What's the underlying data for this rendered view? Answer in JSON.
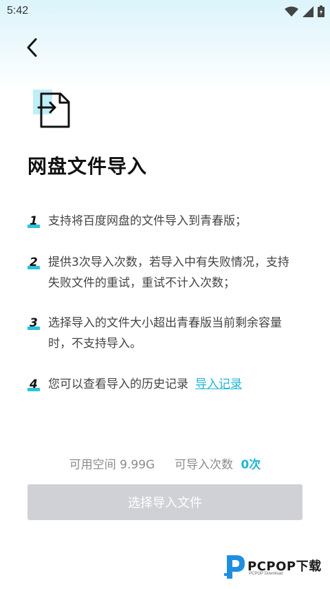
{
  "status_bar": {
    "time": "5:42"
  },
  "page": {
    "title": "网盘文件导入"
  },
  "steps": [
    {
      "num": "1",
      "text": "支持将百度网盘的文件导入到青春版；"
    },
    {
      "num": "2",
      "text": "提供3次导入次数，若导入中有失败情况，支持失败文件的重试，重试不计入次数；"
    },
    {
      "num": "3",
      "text": "选择导入的文件大小超出青春版当前剩余容量时，不支持导入。"
    },
    {
      "num": "4",
      "text": "您可以查看导入的历史记录",
      "link": "导入记录"
    }
  ],
  "info": {
    "space_label": "可用空间",
    "space_value": "9.99G",
    "times_label": "可导入次数",
    "times_value": "0次"
  },
  "button": {
    "label": "选择导入文件"
  },
  "watermark": {
    "brand": "PCPOP下载",
    "sub": "PCPOP Download"
  },
  "colors": {
    "accent": "#1fb6d6",
    "button_disabled": "#cfd1d6",
    "step_bar": "#2bc3dc"
  },
  "icons": [
    "back-arrow-icon",
    "file-import-icon",
    "wifi-icon",
    "signal-icon",
    "battery-icon",
    "pcpop-logo-icon"
  ]
}
